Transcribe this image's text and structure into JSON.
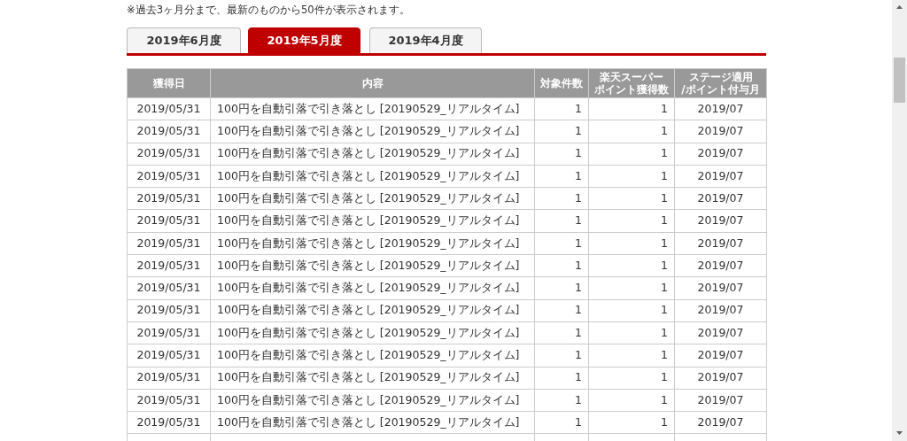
{
  "note": "※過去3ヶ月分まで、最新のものから50件が表示されます。",
  "tabs": [
    {
      "label": "2019年6月度",
      "selected": false
    },
    {
      "label": "2019年5月度",
      "selected": true
    },
    {
      "label": "2019年4月度",
      "selected": false
    }
  ],
  "table": {
    "columns": [
      {
        "lines": [
          "獲得日"
        ]
      },
      {
        "lines": [
          "内容"
        ]
      },
      {
        "lines": [
          "対象件数"
        ]
      },
      {
        "lines": [
          "楽天スーパー",
          "ポイント獲得数"
        ]
      },
      {
        "lines": [
          "ステージ適用",
          "/ポイント付与月"
        ]
      }
    ],
    "rows": [
      [
        "2019/05/31",
        "100円を自動引落で引き落とし [20190529_リアルタイム]",
        "1",
        "1",
        "2019/07"
      ],
      [
        "2019/05/31",
        "100円を自動引落で引き落とし [20190529_リアルタイム]",
        "1",
        "1",
        "2019/07"
      ],
      [
        "2019/05/31",
        "100円を自動引落で引き落とし [20190529_リアルタイム]",
        "1",
        "1",
        "2019/07"
      ],
      [
        "2019/05/31",
        "100円を自動引落で引き落とし [20190529_リアルタイム]",
        "1",
        "1",
        "2019/07"
      ],
      [
        "2019/05/31",
        "100円を自動引落で引き落とし [20190529_リアルタイム]",
        "1",
        "1",
        "2019/07"
      ],
      [
        "2019/05/31",
        "100円を自動引落で引き落とし [20190529_リアルタイム]",
        "1",
        "1",
        "2019/07"
      ],
      [
        "2019/05/31",
        "100円を自動引落で引き落とし [20190529_リアルタイム]",
        "1",
        "1",
        "2019/07"
      ],
      [
        "2019/05/31",
        "100円を自動引落で引き落とし [20190529_リアルタイム]",
        "1",
        "1",
        "2019/07"
      ],
      [
        "2019/05/31",
        "100円を自動引落で引き落とし [20190529_リアルタイム]",
        "1",
        "1",
        "2019/07"
      ],
      [
        "2019/05/31",
        "100円を自動引落で引き落とし [20190529_リアルタイム]",
        "1",
        "1",
        "2019/07"
      ],
      [
        "2019/05/31",
        "100円を自動引落で引き落とし [20190529_リアルタイム]",
        "1",
        "1",
        "2019/07"
      ],
      [
        "2019/05/31",
        "100円を自動引落で引き落とし [20190529_リアルタイム]",
        "1",
        "1",
        "2019/07"
      ],
      [
        "2019/05/31",
        "100円を自動引落で引き落とし [20190529_リアルタイム]",
        "1",
        "1",
        "2019/07"
      ],
      [
        "2019/05/31",
        "100円を自動引落で引き落とし [20190529_リアルタイム]",
        "1",
        "1",
        "2019/07"
      ],
      [
        "2019/05/31",
        "100円を自動引落で引き落とし [20190529_リアルタイム]",
        "1",
        "1",
        "2019/07"
      ]
    ]
  }
}
